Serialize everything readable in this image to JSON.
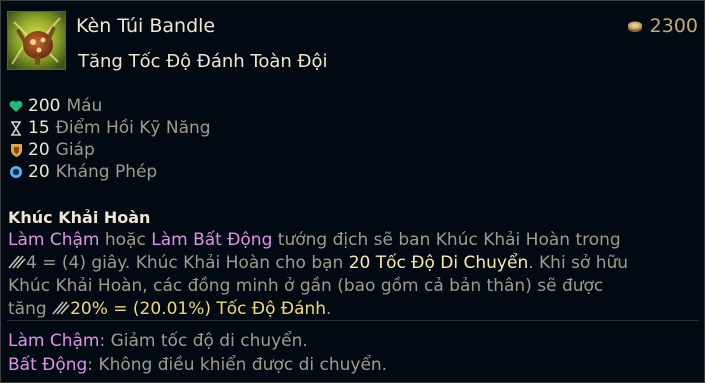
{
  "item": {
    "icon": "bandle-pipes-item-icon",
    "name": "Kèn Túi Bandle",
    "tagline": "Tăng Tốc Độ Đánh Toàn Đội",
    "price": "2300",
    "price_icon": "gold-coin-icon"
  },
  "stats": [
    {
      "icon": "heart-icon",
      "value": "200",
      "label": "Máu",
      "color": "#1fbf7b"
    },
    {
      "icon": "hourglass-icon",
      "value": "15",
      "label": "Điểm Hồi Kỹ Năng",
      "color": "#d8d2c4"
    },
    {
      "icon": "shield-icon",
      "value": "20",
      "label": "Giáp",
      "color": "#e6a03c"
    },
    {
      "icon": "magic-resist-icon",
      "value": "20",
      "label": "Kháng Phép",
      "color": "#4fb8f0"
    }
  ],
  "passive": {
    "title": "Khúc Khải Hoàn",
    "line1": {
      "kw_slow": "Làm Chậm",
      "t1": " hoặc ",
      "kw_immobilize": "Làm Bất Động",
      "t2": " tướng địch sẽ ban Khúc Khải Hoàn trong"
    },
    "line2": {
      "t1": "4 = (4) giây. Khúc Khải Hoàn cho bạn ",
      "ms": "20 Tốc Độ Di Chuyển",
      "t2": ". Khi sở hữu"
    },
    "line3": "Khúc Khải Hoàn, các đồng minh ở gần (bao gồm cả bản thân) sẽ được",
    "line4": {
      "t1": "tăng ",
      "as": "20% = (20.01%) Tốc Độ Đánh",
      "t2": "."
    }
  },
  "keywords": [
    {
      "term": "Làm Chậm",
      "definition": ": Giảm tốc độ di chuyển."
    },
    {
      "term": "Bất Động",
      "definition": ": Không điều khiển được di chuyển."
    }
  ]
}
